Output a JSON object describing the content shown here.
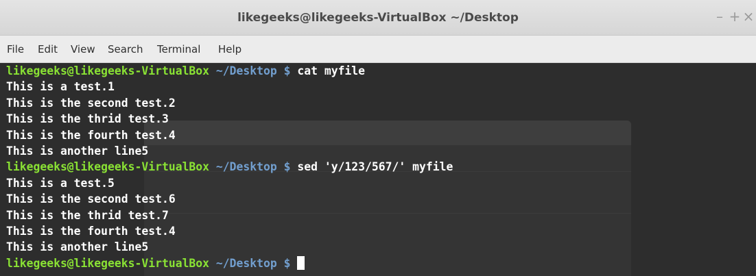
{
  "window": {
    "title": "likegeeks@likegeeks-VirtualBox ~/Desktop",
    "controls": {
      "minimize": "–",
      "maximize": "+",
      "close": "×"
    }
  },
  "menubar": {
    "items": [
      "File",
      "Edit",
      "View",
      "Search",
      "Terminal",
      "Help"
    ]
  },
  "terminal": {
    "prompt_user": "likegeeks@likegeeks-VirtualBox",
    "prompt_path": "~/Desktop",
    "prompt_symbol": "$",
    "commands": [
      "cat myfile",
      "sed 'y/123/567/' myfile",
      ""
    ],
    "output_1": [
      "This is a test.1",
      "This is the second test.2",
      "This is the thrid test.3",
      "This is the fourth test.4",
      "This is another line5"
    ],
    "output_2": [
      "This is a test.5",
      "This is the second test.6",
      "This is the thrid test.7",
      "This is the fourth test.4",
      "This is another line5"
    ]
  },
  "colors": {
    "prompt_user": "#8ae234",
    "prompt_path": "#729fcf",
    "background": "#2d2d2d",
    "text": "#ffffff"
  }
}
